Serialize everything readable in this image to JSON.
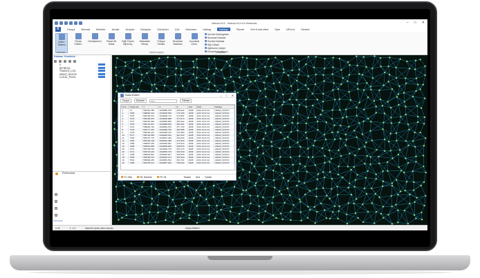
{
  "window": {
    "title": "Netcad 8.5 - Netcad 8.5 for Windows",
    "controls": [
      "–",
      "□",
      "✕"
    ]
  },
  "menu": {
    "tabs": [
      "Dosya",
      "Netcad",
      "Birimler",
      "Analiz",
      "Araçlar",
      "Detaylar",
      "Görünüm",
      "Çizi",
      "Netcamu",
      "Katlag",
      "Haritap",
      "Planet",
      "Veri Kontrolleri",
      "Spis",
      "NForm",
      "Destek"
    ],
    "active_tab": "Haritap"
  },
  "ribbon": {
    "buttons": [
      {
        "label": "Netlcc Tablosu",
        "active": true
      },
      {
        "label": "Parsla Editörü",
        "active": false
      },
      {
        "label": "Dönüştürücü",
        "active": false
      },
      {
        "label": "Parsel Ait Nokta",
        "active": false
      },
      {
        "label": "Eğik Parsel Eğimi Ay.",
        "active": false
      },
      {
        "label": "Tabandaki Hesap",
        "active": false
      },
      {
        "label": "Poligon Hesabı",
        "active": false
      },
      {
        "label": "Nivelmân Noktaları",
        "active": false
      },
      {
        "label": "Koordinat Dönü.",
        "active": false
      }
    ],
    "list_items": [
      "Çevrimi Kaldır/göster",
      "Numaralı Noktalar",
      "Sembol Noktalar",
      "Ağlı Çalıştır",
      "Ağlöncüm Çalıştır",
      "Ekonmik Açığlaşıyın"
    ],
    "group_labels": [
      "Haritalar",
      "Harita Araçları",
      "Koordinat"
    ]
  },
  "sidebar": {
    "title": "Katman Yöneticisi",
    "layers": [
      "0",
      "[EPIBOX]",
      "TRAVES_LOG",
      "ARAZI_NOKTA",
      "LOCAL_PIXEL"
    ],
    "references_label": "Referanslar",
    "vertical_tab": "Katmanlar"
  },
  "dialog": {
    "title": "Nokta Editörü",
    "toolbar": {
      "select_label": "Dosya",
      "edit_label": "Düzenle",
      "search_placeholder": "Ara",
      "filter_label": "Filtreler"
    },
    "columns": [
      "Sıra",
      "Nokta Adı",
      "Y",
      "X",
      "Z",
      "Kod",
      "Tarih",
      "Tabaka"
    ],
    "rows": [
      [
        "1",
        "T1",
        "566781.788",
        "4334856.678",
        "405.942",
        "2068",
        "2/03 13:21:14",
        "ARAZI_NOKTA"
      ],
      [
        "2",
        "T465",
        "569803.319",
        "4334836.535",
        "276.780",
        "2068",
        "2/03 13:21:14",
        "ARAZI_NOKTA"
      ],
      [
        "3",
        "T475",
        "566795.373",
        "4334802.775",
        "372.887",
        "2068",
        "2/03 13:21:14",
        "ARAZI_NOKTA"
      ],
      [
        "4",
        "T476",
        "569789.079",
        "4334896.988",
        "374.372",
        "2068",
        "2/03 13:21:14",
        "ARAZI_NOKTA"
      ],
      [
        "5",
        "T477",
        "566781.029",
        "4334863.686",
        "384.322",
        "2068",
        "2/03 13:21:14",
        "ARAZI_NOKTA"
      ],
      [
        "6",
        "T478",
        "566723.007",
        "4334888.930",
        "381.991",
        "2068",
        "2/03 13:21:14",
        "ARAZI_NOKTA"
      ],
      [
        "7",
        "T473",
        "569694.732",
        "4334840.679",
        "377.723",
        "2068",
        "2/03 13:21:14",
        "ARAZI_NOKTA"
      ],
      [
        "8",
        "T478",
        "566777.153",
        "4334884.756",
        "384.985",
        "2068",
        "2/03 13:21:14",
        "ARAZI_NOKTA"
      ],
      [
        "9",
        "T479",
        "566782.412",
        "4334935.412",
        "376.380",
        "2068",
        "2/03 13:21:14",
        "ARAZI_NOKTA"
      ],
      [
        "10",
        "T477",
        "566746.095",
        "4334836.322",
        "367.633",
        "2068",
        "2/03 13:21:14",
        "ARAZI_NOKTA"
      ],
      [
        "11",
        "T463",
        "566797.775",
        "4334837.349",
        "354.260",
        "2068",
        "2/03 13:21:14",
        "ARAZI_NOKTA"
      ],
      [
        "12",
        "T484",
        "566790.128",
        "4334844.485",
        "376.203",
        "2068",
        "2/03 13:21:14",
        "ARAZI_NOKTA"
      ],
      [
        "13",
        "T489",
        "566807.165",
        "4334945.487",
        "376.223",
        "2068",
        "2/03 13:21:14",
        "ARAZI_NOKTA"
      ],
      [
        "14",
        "T483",
        "566801.982",
        "4334808.990",
        "368.915",
        "2068",
        "2/03 13:21:14",
        "ARAZI_NOKTA"
      ],
      [
        "15",
        "T474",
        "566796.195",
        "4334992.715",
        "364.170",
        "2068",
        "2/03 13:21:14",
        "ARAZI_NOKTA"
      ],
      [
        "16",
        "T471",
        "569740.109",
        "4334836.725",
        "363.630",
        "2068",
        "2/03 13:21:14",
        "ARAZI_NOKTA"
      ],
      [
        "17",
        "T495",
        "566819.861",
        "4334822.607",
        "369.560",
        "2068",
        "2/03 13:21:14",
        "ARAZI_NOKTA"
      ],
      [
        "18",
        "T502",
        "566780.313",
        "4334832.471",
        "362.920",
        "2068",
        "2/03 13:21:14",
        "ARAZI_NOKTA"
      ],
      [
        "19",
        "T522",
        "566800.183",
        "4334861.543",
        "364.721",
        "2068",
        "2/03 13:21:14",
        "ARAZI_NOKTA"
      ],
      [
        "20",
        "T489",
        "566793.101",
        "4334857.930",
        "359.002",
        "2068",
        "2/03 13:21:14",
        "ARAZI_NOKTA"
      ]
    ],
    "footer": [
      "F2: Ekle",
      "F8: Düzenle",
      "F9: Sil",
      "Tamam",
      "Sed",
      "Yardım"
    ]
  },
  "status": {
    "coords": "0.00",
    "scale": "1: 1.0",
    "message": "İşlemleri çizim alanı seçiniz",
    "center": "Nokta Editörü"
  },
  "colors": {
    "map_bg": "#07130f",
    "mesh": "#1b7fb0",
    "points": "#8edc78",
    "accent": "#3d6bb3"
  }
}
